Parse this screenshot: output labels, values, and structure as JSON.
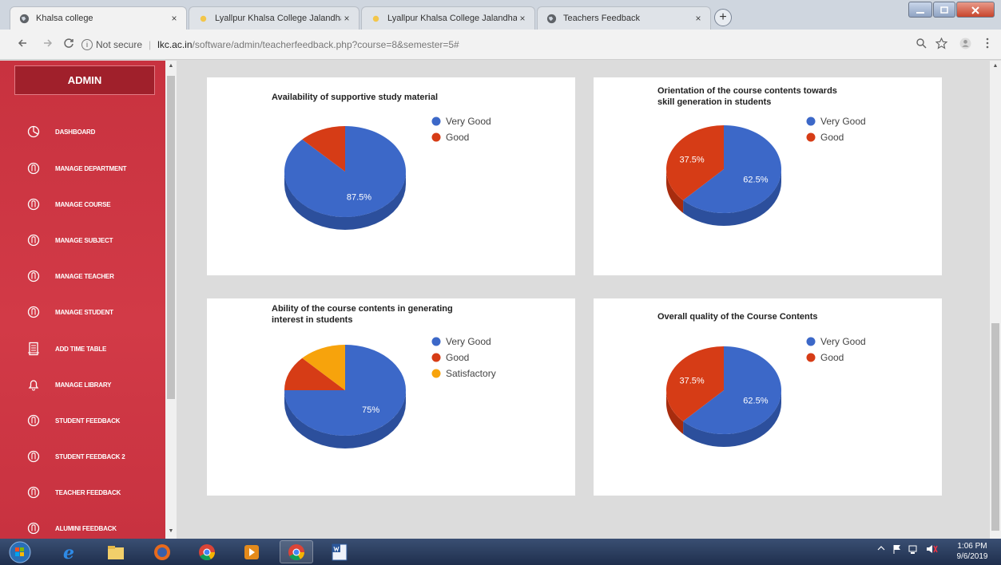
{
  "browser": {
    "tabs": [
      {
        "title": "Khalsa college",
        "active": true
      },
      {
        "title": "Lyallpur Khalsa College Jalandhar",
        "active": false
      },
      {
        "title": "Lyallpur Khalsa College Jalandhar",
        "active": false
      },
      {
        "title": "Teachers Feedback",
        "active": false
      }
    ],
    "close_glyph": "×",
    "new_tab_glyph": "+",
    "security_label": "Not secure",
    "url_host": "lkc.ac.in",
    "url_path": "/software/admin/teacherfeedback.php?course=8&semester=5#"
  },
  "sidebar": {
    "title": "ADMIN",
    "items": [
      {
        "label": "DASHBOARD",
        "icon": "pie-icon"
      },
      {
        "label": "MANAGE DEPARTMENT",
        "icon": "circle-icon"
      },
      {
        "label": "MANAGE COURSE",
        "icon": "circle-icon"
      },
      {
        "label": "MANAGE SUBJECT",
        "icon": "circle-icon"
      },
      {
        "label": "MANAGE TEACHER",
        "icon": "circle-icon"
      },
      {
        "label": "MANAGE STUDENT",
        "icon": "circle-icon"
      },
      {
        "label": "ADD TIME TABLE",
        "icon": "document-icon"
      },
      {
        "label": "MANAGE LIBRARY",
        "icon": "bell-icon"
      },
      {
        "label": "STUDENT FEEDBACK",
        "icon": "circle-icon"
      },
      {
        "label": "STUDENT FEEDBACK 2",
        "icon": "circle-icon"
      },
      {
        "label": "TEACHER FEEDBACK",
        "icon": "circle-icon"
      },
      {
        "label": "ALUMINI FEEDBACK",
        "icon": "circle-icon"
      }
    ]
  },
  "colors": {
    "very_good": "#3c68c8",
    "good": "#d63c16",
    "satisfactory": "#f7a30c"
  },
  "chart_data": [
    {
      "type": "pie",
      "title": [
        "Availability of supportive study material"
      ],
      "categories": [
        "Very Good",
        "Good"
      ],
      "values": [
        87.5,
        12.5
      ],
      "data_labels": [
        "87.5%",
        ""
      ],
      "legend_position": "right"
    },
    {
      "type": "pie",
      "title": [
        "Orientation of the course contents towards",
        "skill generation in students"
      ],
      "categories": [
        "Very Good",
        "Good"
      ],
      "values": [
        62.5,
        37.5
      ],
      "data_labels": [
        "62.5%",
        "37.5%"
      ],
      "legend_position": "right"
    },
    {
      "type": "pie",
      "title": [
        "Ability of the course contents in generating",
        "interest in students"
      ],
      "categories": [
        "Very Good",
        "Good",
        "Satisfactory"
      ],
      "values": [
        75,
        12.5,
        12.5
      ],
      "data_labels": [
        "75%",
        "",
        ""
      ],
      "legend_position": "right"
    },
    {
      "type": "pie",
      "title": [
        "Overall quality of the Course Contents"
      ],
      "categories": [
        "Very Good",
        "Good"
      ],
      "values": [
        62.5,
        37.5
      ],
      "data_labels": [
        "62.5%",
        "37.5%"
      ],
      "legend_position": "right"
    }
  ],
  "taskbar": {
    "time": "1:06 PM",
    "date": "9/6/2019"
  }
}
